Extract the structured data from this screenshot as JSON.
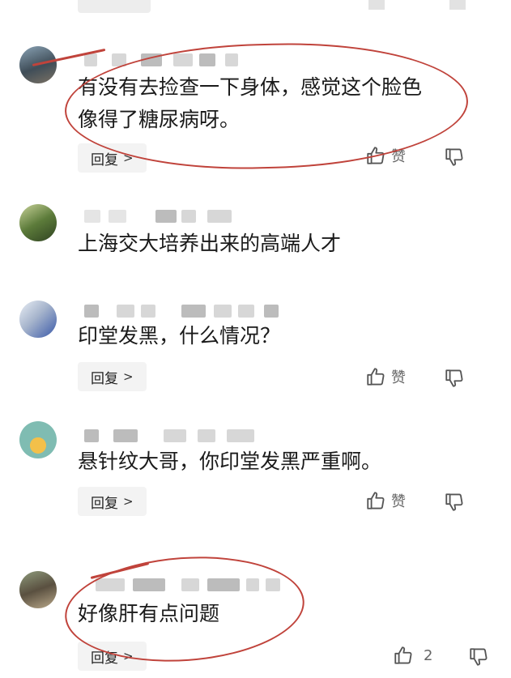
{
  "comments": [
    {
      "text_lines": [
        "有没有去捡查一下身体，感觉这个脸色",
        "像得了糖尿病呀。"
      ],
      "reply": "回复",
      "like": "赞"
    },
    {
      "text_lines": [
        "上海交大培养出来的高端人才"
      ]
    },
    {
      "text_lines": [
        "印堂发黑，什么情况？"
      ],
      "reply": "回复",
      "like": "赞"
    },
    {
      "text_lines": [
        "悬针纹大哥，你印堂发黑严重啊。"
      ],
      "reply": "回复",
      "like": "赞"
    },
    {
      "text_lines": [
        "好像肝有点问题"
      ],
      "reply": "回复",
      "like": "2"
    }
  ],
  "icons": {
    "like": "thumbs-up-icon",
    "dislike": "thumbs-down-icon",
    "chevron": "chevron-right-icon"
  },
  "colors": {
    "annotation": "#c0433b",
    "reply_bg": "#f3f3f3"
  }
}
